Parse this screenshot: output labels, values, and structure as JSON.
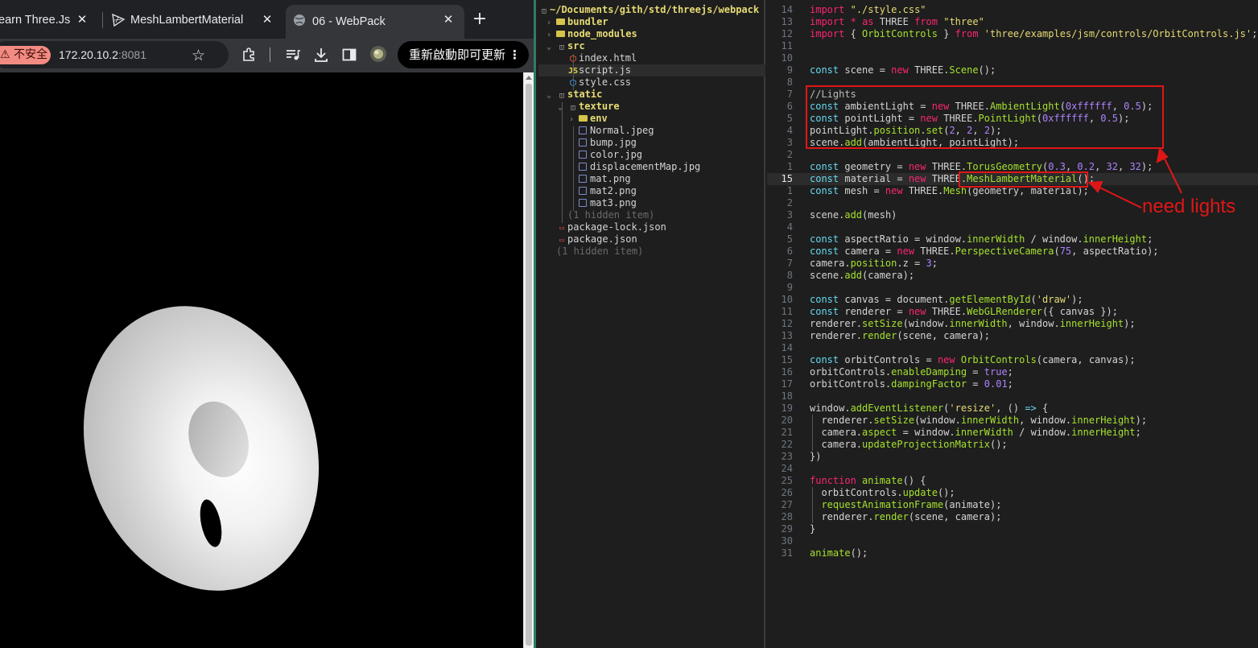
{
  "browser": {
    "tabs": [
      {
        "label": "earn Three.Js",
        "active": false
      },
      {
        "label": "MeshLambertMaterial",
        "active": false
      },
      {
        "label": "06 - WebPack",
        "active": true
      }
    ],
    "insecure_label": "⚠ 不安全",
    "url_host": "172.20.10.2",
    "url_port": ":8081",
    "update_button": "重新啟動即可更新",
    "viewport_content": "torus-render"
  },
  "file_tree": {
    "root_path": "~/Documents/gith/std/threejs/webpack",
    "items": [
      {
        "label": "bundler",
        "kind": "dir",
        "expanded": false,
        "depth": 0
      },
      {
        "label": "node_modules",
        "kind": "dir",
        "expanded": false,
        "depth": 0
      },
      {
        "label": "src",
        "kind": "dir",
        "expanded": true,
        "depth": 0
      },
      {
        "label": "index.html",
        "kind": "html",
        "depth": 1
      },
      {
        "label": "script.js",
        "kind": "js",
        "depth": 1,
        "selected": true
      },
      {
        "label": "style.css",
        "kind": "css",
        "depth": 1
      },
      {
        "label": "static",
        "kind": "dir",
        "expanded": true,
        "depth": 0
      },
      {
        "label": "texture",
        "kind": "dir",
        "expanded": true,
        "depth": 1
      },
      {
        "label": "env",
        "kind": "dir",
        "expanded": false,
        "depth": 2
      },
      {
        "label": "Normal.jpeg",
        "kind": "img",
        "depth": 2
      },
      {
        "label": "bump.jpg",
        "kind": "img",
        "depth": 2
      },
      {
        "label": "color.jpg",
        "kind": "img",
        "depth": 2
      },
      {
        "label": "displacementMap.jpg",
        "kind": "img",
        "depth": 2
      },
      {
        "label": "mat.png",
        "kind": "img",
        "depth": 2
      },
      {
        "label": "mat2.png",
        "kind": "img",
        "depth": 2
      },
      {
        "label": "mat3.png",
        "kind": "img",
        "depth": 2
      },
      {
        "label": "(1 hidden item)",
        "kind": "hidden",
        "depth": 1
      },
      {
        "label": "package-lock.json",
        "kind": "json",
        "depth": 0
      },
      {
        "label": "package.json",
        "kind": "json",
        "depth": 0
      },
      {
        "label": "(1 hidden item)",
        "kind": "hidden",
        "depth": -1
      }
    ]
  },
  "editor": {
    "current_line": "15",
    "lines": [
      {
        "n": "14",
        "t": [
          [
            "kw",
            "import"
          ],
          [
            "p",
            " "
          ],
          [
            "str",
            "\"./style.css\""
          ]
        ]
      },
      {
        "n": "13",
        "t": [
          [
            "kw",
            "import"
          ],
          [
            "p",
            " "
          ],
          [
            "kw",
            "*"
          ],
          [
            "p",
            " "
          ],
          [
            "kw",
            "as"
          ],
          [
            "p",
            " THREE "
          ],
          [
            "kw",
            "from"
          ],
          [
            "p",
            " "
          ],
          [
            "str",
            "\"three\""
          ]
        ]
      },
      {
        "n": "12",
        "t": [
          [
            "kw",
            "import"
          ],
          [
            "p",
            " { "
          ],
          [
            "fn",
            "OrbitControls"
          ],
          [
            "p",
            " } "
          ],
          [
            "kw",
            "from"
          ],
          [
            "p",
            " "
          ],
          [
            "str",
            "'three/examples/jsm/controls/OrbitControls.js'"
          ],
          [
            "p",
            ";"
          ]
        ]
      },
      {
        "n": "11",
        "t": []
      },
      {
        "n": "10",
        "t": []
      },
      {
        "n": "9",
        "t": [
          [
            "kw2",
            "const"
          ],
          [
            "p",
            " scene = "
          ],
          [
            "kw",
            "new"
          ],
          [
            "p",
            " THREE."
          ],
          [
            "fn",
            "Scene"
          ],
          [
            "p",
            "();"
          ]
        ]
      },
      {
        "n": "8",
        "t": []
      },
      {
        "n": "7",
        "t": [
          [
            "cm",
            "//Lights"
          ]
        ]
      },
      {
        "n": "6",
        "t": [
          [
            "kw2",
            "const"
          ],
          [
            "p",
            " ambientLight = "
          ],
          [
            "kw",
            "new"
          ],
          [
            "p",
            " THREE."
          ],
          [
            "fn",
            "AmbientLight"
          ],
          [
            "p",
            "("
          ],
          [
            "num",
            "0xffffff"
          ],
          [
            "p",
            ", "
          ],
          [
            "num",
            "0.5"
          ],
          [
            "p",
            ");"
          ]
        ]
      },
      {
        "n": "5",
        "t": [
          [
            "kw2",
            "const"
          ],
          [
            "p",
            " pointLight = "
          ],
          [
            "kw",
            "new"
          ],
          [
            "p",
            " THREE."
          ],
          [
            "fn",
            "PointLight"
          ],
          [
            "p",
            "("
          ],
          [
            "num",
            "0xffffff"
          ],
          [
            "p",
            ", "
          ],
          [
            "num",
            "0.5"
          ],
          [
            "p",
            ");"
          ]
        ]
      },
      {
        "n": "4",
        "t": [
          [
            "p",
            "pointLight."
          ],
          [
            "fn",
            "position"
          ],
          [
            "p",
            "."
          ],
          [
            "fn",
            "set"
          ],
          [
            "p",
            "("
          ],
          [
            "num",
            "2"
          ],
          [
            "p",
            ", "
          ],
          [
            "num",
            "2"
          ],
          [
            "p",
            ", "
          ],
          [
            "num",
            "2"
          ],
          [
            "p",
            ");"
          ]
        ]
      },
      {
        "n": "3",
        "t": [
          [
            "p",
            "scene."
          ],
          [
            "fn",
            "add"
          ],
          [
            "p",
            "(ambientLight, pointLight);"
          ]
        ]
      },
      {
        "n": "2",
        "t": []
      },
      {
        "n": "1",
        "t": [
          [
            "kw2",
            "const"
          ],
          [
            "p",
            " geometry = "
          ],
          [
            "kw",
            "new"
          ],
          [
            "p",
            " THREE."
          ],
          [
            "fn",
            "TorusGeometry"
          ],
          [
            "p",
            "("
          ],
          [
            "num",
            "0.3"
          ],
          [
            "p",
            ", "
          ],
          [
            "num",
            "0.2"
          ],
          [
            "p",
            ", "
          ],
          [
            "num",
            "32"
          ],
          [
            "p",
            ", "
          ],
          [
            "num",
            "32"
          ],
          [
            "p",
            ");"
          ]
        ]
      },
      {
        "n": "15",
        "t": [
          [
            "kw2",
            "const"
          ],
          [
            "p",
            " material = "
          ],
          [
            "kw",
            "new"
          ],
          [
            "p",
            " THREE."
          ],
          [
            "fn",
            "MeshLambertMaterial"
          ],
          [
            "p",
            "();"
          ]
        ]
      },
      {
        "n": "1",
        "t": [
          [
            "kw2",
            "const"
          ],
          [
            "p",
            " mesh = "
          ],
          [
            "kw",
            "new"
          ],
          [
            "p",
            " THREE."
          ],
          [
            "fn",
            "Mesh"
          ],
          [
            "p",
            "(geometry, material);"
          ]
        ]
      },
      {
        "n": "2",
        "t": []
      },
      {
        "n": "3",
        "t": [
          [
            "p",
            "scene."
          ],
          [
            "fn",
            "add"
          ],
          [
            "p",
            "(mesh)"
          ]
        ]
      },
      {
        "n": "4",
        "t": []
      },
      {
        "n": "5",
        "t": [
          [
            "kw2",
            "const"
          ],
          [
            "p",
            " aspectRatio = window."
          ],
          [
            "fn",
            "innerWidth"
          ],
          [
            "p",
            " / window."
          ],
          [
            "fn",
            "innerHeight"
          ],
          [
            "p",
            ";"
          ]
        ]
      },
      {
        "n": "6",
        "t": [
          [
            "kw2",
            "const"
          ],
          [
            "p",
            " camera = "
          ],
          [
            "kw",
            "new"
          ],
          [
            "p",
            " THREE."
          ],
          [
            "fn",
            "PerspectiveCamera"
          ],
          [
            "p",
            "("
          ],
          [
            "num",
            "75"
          ],
          [
            "p",
            ", aspectRatio);"
          ]
        ]
      },
      {
        "n": "7",
        "t": [
          [
            "p",
            "camera."
          ],
          [
            "fn",
            "position"
          ],
          [
            "p",
            ".z = "
          ],
          [
            "num",
            "3"
          ],
          [
            "p",
            ";"
          ]
        ]
      },
      {
        "n": "8",
        "t": [
          [
            "p",
            "scene."
          ],
          [
            "fn",
            "add"
          ],
          [
            "p",
            "(camera);"
          ]
        ]
      },
      {
        "n": "9",
        "t": []
      },
      {
        "n": "10",
        "t": [
          [
            "kw2",
            "const"
          ],
          [
            "p",
            " canvas = document."
          ],
          [
            "fn",
            "getElementById"
          ],
          [
            "p",
            "("
          ],
          [
            "str",
            "'draw'"
          ],
          [
            "p",
            ");"
          ]
        ]
      },
      {
        "n": "11",
        "t": [
          [
            "kw2",
            "const"
          ],
          [
            "p",
            " renderer = "
          ],
          [
            "kw",
            "new"
          ],
          [
            "p",
            " THREE."
          ],
          [
            "fn",
            "WebGLRenderer"
          ],
          [
            "p",
            "({ canvas });"
          ]
        ]
      },
      {
        "n": "12",
        "t": [
          [
            "p",
            "renderer."
          ],
          [
            "fn",
            "setSize"
          ],
          [
            "p",
            "(window."
          ],
          [
            "fn",
            "innerWidth"
          ],
          [
            "p",
            ", window."
          ],
          [
            "fn",
            "innerHeight"
          ],
          [
            "p",
            ");"
          ]
        ]
      },
      {
        "n": "13",
        "t": [
          [
            "p",
            "renderer."
          ],
          [
            "fn",
            "render"
          ],
          [
            "p",
            "(scene, camera);"
          ]
        ]
      },
      {
        "n": "14",
        "t": []
      },
      {
        "n": "15",
        "t": [
          [
            "kw2",
            "const"
          ],
          [
            "p",
            " orbitControls = "
          ],
          [
            "kw",
            "new"
          ],
          [
            "p",
            " "
          ],
          [
            "fn",
            "OrbitControls"
          ],
          [
            "p",
            "(camera, canvas);"
          ]
        ]
      },
      {
        "n": "16",
        "t": [
          [
            "p",
            "orbitControls."
          ],
          [
            "fn",
            "enableDamping"
          ],
          [
            "p",
            " = "
          ],
          [
            "num",
            "true"
          ],
          [
            "p",
            ";"
          ]
        ]
      },
      {
        "n": "17",
        "t": [
          [
            "p",
            "orbitControls."
          ],
          [
            "fn",
            "dampingFactor"
          ],
          [
            "p",
            " = "
          ],
          [
            "num",
            "0.01"
          ],
          [
            "p",
            ";"
          ]
        ]
      },
      {
        "n": "18",
        "t": []
      },
      {
        "n": "19",
        "t": [
          [
            "p",
            "window."
          ],
          [
            "fn",
            "addEventListener"
          ],
          [
            "p",
            "("
          ],
          [
            "str",
            "'resize'"
          ],
          [
            "p",
            ", () "
          ],
          [
            "kw2",
            "=>"
          ],
          [
            "p",
            " {"
          ]
        ]
      },
      {
        "n": "20",
        "t": [
          [
            "p",
            "  renderer."
          ],
          [
            "fn",
            "setSize"
          ],
          [
            "p",
            "(window."
          ],
          [
            "fn",
            "innerWidth"
          ],
          [
            "p",
            ", window."
          ],
          [
            "fn",
            "innerHeight"
          ],
          [
            "p",
            ");"
          ]
        ]
      },
      {
        "n": "21",
        "t": [
          [
            "p",
            "  camera."
          ],
          [
            "fn",
            "aspect"
          ],
          [
            "p",
            " = window."
          ],
          [
            "fn",
            "innerWidth"
          ],
          [
            "p",
            " / window."
          ],
          [
            "fn",
            "innerHeight"
          ],
          [
            "p",
            ";"
          ]
        ]
      },
      {
        "n": "22",
        "t": [
          [
            "p",
            "  camera."
          ],
          [
            "fn",
            "updateProjectionMatrix"
          ],
          [
            "p",
            "();"
          ]
        ]
      },
      {
        "n": "23",
        "t": [
          [
            "p",
            "})"
          ]
        ]
      },
      {
        "n": "24",
        "t": []
      },
      {
        "n": "25",
        "t": [
          [
            "kw",
            "function"
          ],
          [
            "p",
            " "
          ],
          [
            "fn",
            "animate"
          ],
          [
            "p",
            "() {"
          ]
        ]
      },
      {
        "n": "26",
        "t": [
          [
            "p",
            "  orbitControls."
          ],
          [
            "fn",
            "update"
          ],
          [
            "p",
            "();"
          ]
        ]
      },
      {
        "n": "27",
        "t": [
          [
            "p",
            "  "
          ],
          [
            "fn",
            "requestAnimationFrame"
          ],
          [
            "p",
            "(animate);"
          ]
        ]
      },
      {
        "n": "28",
        "t": [
          [
            "p",
            "  renderer."
          ],
          [
            "fn",
            "render"
          ],
          [
            "p",
            "(scene, camera);"
          ]
        ]
      },
      {
        "n": "29",
        "t": [
          [
            "p",
            "}"
          ]
        ]
      },
      {
        "n": "30",
        "t": []
      },
      {
        "n": "31",
        "t": [
          [
            "fn",
            "animate"
          ],
          [
            "p",
            "();"
          ]
        ]
      }
    ]
  },
  "annotation": {
    "label": "need lights",
    "color": "#e01616"
  }
}
